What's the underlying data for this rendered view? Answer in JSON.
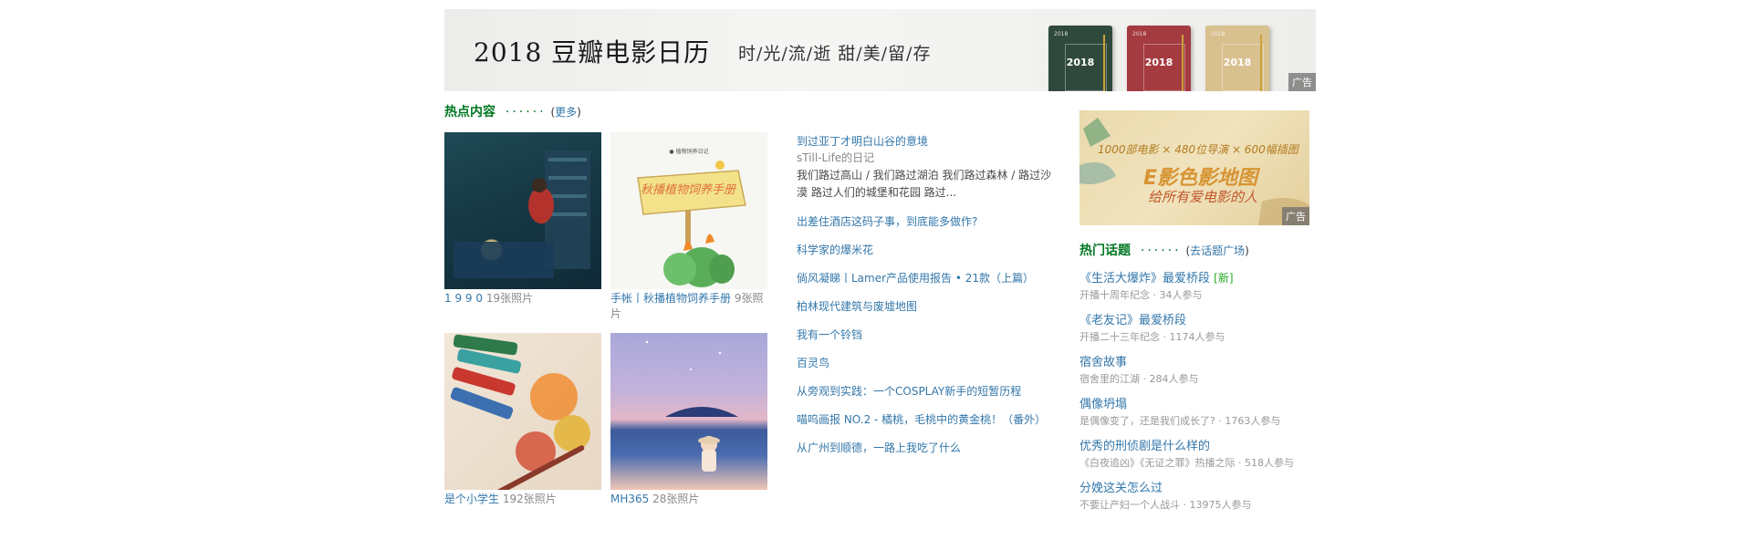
{
  "banner": {
    "year_title": "2018  豆瓣电影日历",
    "slogan": "时/光/流/逝   甜/美/留/存",
    "book_year": "2018",
    "book_brand": "豆瓣电影日历",
    "ad_label": "广告"
  },
  "hot": {
    "title": "热点内容",
    "dots": "······",
    "paren_open": "(",
    "more": "更多",
    "paren_close": ")"
  },
  "albums": [
    {
      "name": "1 9 9 0",
      "count": "19张照片"
    },
    {
      "name": "手帐丨秋播植物饲养手册",
      "count": "9张照片",
      "thumb_text": "秋播植物饲养手册",
      "thumb_header": "● 植物饲养日记"
    },
    {
      "name": "是个小学生",
      "count": "192张照片"
    },
    {
      "name": "MH365",
      "count": "28张照片"
    }
  ],
  "articles": [
    {
      "title": "到过亚丁才明白山谷的意境",
      "author": "sTill-Life的日记",
      "desc": "我们路过高山 / 我们路过湖泊 我们路过森林 / 路过沙漠 路过人们的城堡和花园 路过..."
    },
    {
      "title": "出差住酒店这码子事，到底能多做作?"
    },
    {
      "title": "科学家的爆米花"
    },
    {
      "title": "倘风凝睇丨Lamer产品使用报告 • 21款（上篇）"
    },
    {
      "title": "柏林现代建筑与废墟地图"
    },
    {
      "title": "我有一个铃铛"
    },
    {
      "title": "百灵鸟"
    },
    {
      "title": "从旁观到实践：一个COSPLAY新手的短暂历程"
    },
    {
      "title": "喵呜画报 NO.2 - 橘桃，毛桃中的黄金桃！（番外）"
    },
    {
      "title": "从广州到顺德，一路上我吃了什么"
    }
  ],
  "side_ad": {
    "line1": "1000部电影 × 480位导演 × 600幅插图",
    "title": "E影色影地图",
    "line2": "给所有爱电影的人",
    "ad_label": "广告"
  },
  "topics_header": {
    "title": "热门话题",
    "dots": "······",
    "paren_open": "(",
    "more": "去话题广场",
    "paren_close": ")"
  },
  "topics": [
    {
      "name": "《生活大爆炸》最爱桥段",
      "badge": "[新]",
      "meta": "开播十周年纪念 · 34人参与"
    },
    {
      "name": "《老友记》最爱桥段",
      "meta": "开播二十三年纪念 · 1174人参与"
    },
    {
      "name": "宿舍故事",
      "meta": "宿舍里的江湖 · 284人参与"
    },
    {
      "name": "偶像坍塌",
      "meta": "是偶像变了，还是我们成长了? · 1763人参与"
    },
    {
      "name": "优秀的刑侦剧是什么样的",
      "meta": "《白夜追凶》《无证之罪》热播之际 · 518人参与"
    },
    {
      "name": "分娩这关怎么过",
      "meta": "不要让产妇一个人战斗 · 13975人参与"
    }
  ],
  "colors": {
    "link": "#3377aa",
    "section_green": "#007722",
    "new_badge": "#22aa22",
    "meta_gray": "#999999",
    "book_green": "#2f4a3c",
    "book_red": "#a43b40",
    "book_beige": "#d9c08f"
  }
}
